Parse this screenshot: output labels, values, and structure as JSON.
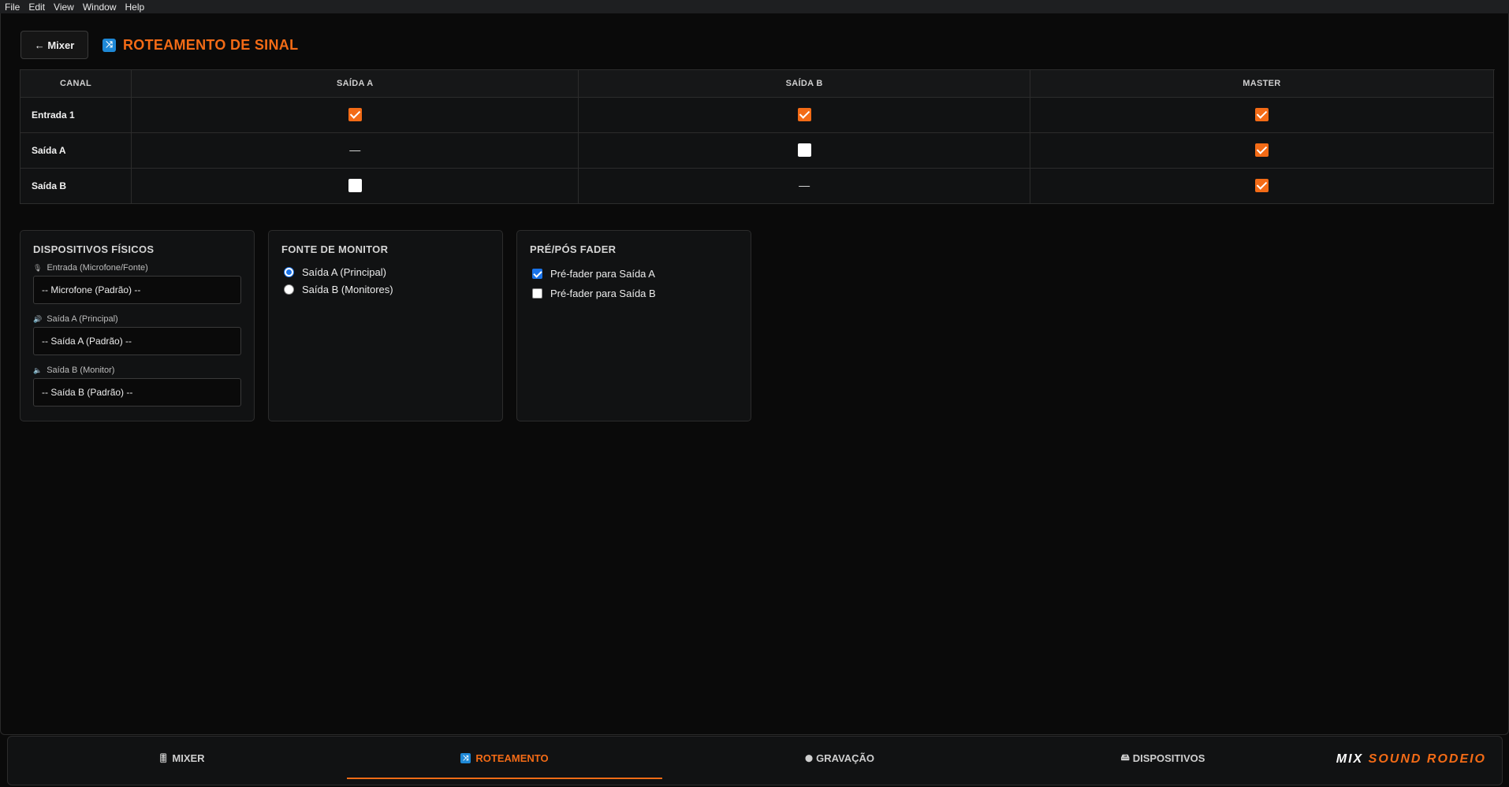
{
  "menu": [
    "File",
    "Edit",
    "View",
    "Window",
    "Help"
  ],
  "header": {
    "back_label": "← Mixer",
    "title_icon": "⤨",
    "title": "ROTEAMENTO DE SINAL"
  },
  "routing": {
    "columns": [
      "CANAL",
      "SAÍDA A",
      "SAÍDA B",
      "MASTER"
    ],
    "rows": [
      {
        "label": "Entrada 1",
        "cells": [
          "on",
          "on",
          "on"
        ]
      },
      {
        "label": "Saída A",
        "cells": [
          "none",
          "off",
          "on"
        ]
      },
      {
        "label": "Saída B",
        "cells": [
          "off",
          "none",
          "on"
        ]
      }
    ],
    "dash": "—"
  },
  "devices": {
    "title": "DISPOSITIVOS FÍSICOS",
    "input_icon": "🎙",
    "input_label": "Entrada (Microfone/Fonte)",
    "input_value": "-- Microfone (Padrão) --",
    "out_a_icon": "🔊",
    "out_a_label": "Saída A (Principal)",
    "out_a_value": "-- Saída A (Padrão) --",
    "out_b_icon": "🔈",
    "out_b_label": "Saída B (Monitor)",
    "out_b_value": "-- Saída B (Padrão) --"
  },
  "monitor": {
    "title": "FONTE DE MONITOR",
    "option_a": "Saída A (Principal)",
    "option_b": "Saída B (Monitores)",
    "selected": "a"
  },
  "fader": {
    "title": "PRÉ/PÓS FADER",
    "option_a": "Pré-fader para Saída A",
    "option_a_checked": true,
    "option_b": "Pré-fader para Saída B",
    "option_b_checked": false
  },
  "nav": {
    "mixer_icon": "🎚",
    "mixer": "MIXER",
    "routing_icon": "⤨",
    "routing": "ROTEAMENTO",
    "recording_icon": "⬤",
    "recording": "GRAVAÇÃO",
    "devices_icon": "🖴",
    "devices": "DISPOSITIVOS"
  },
  "brand": {
    "part1": "MIX ",
    "part2": "SOUND RODEIO"
  },
  "colors": {
    "accent": "#f36b16",
    "blue": "#1e88d6",
    "background": "#0a0a0a",
    "panel": "#111213"
  }
}
